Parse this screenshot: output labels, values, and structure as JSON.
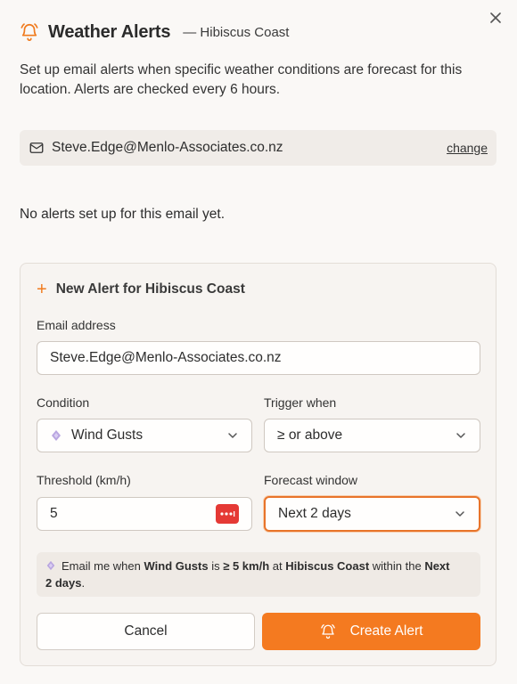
{
  "header": {
    "title": "Weather Alerts",
    "subtitle": "— Hibiscus Coast",
    "accent_color": "#f07b1e"
  },
  "description": "Set up email alerts when specific weather conditions are forecast for this location. Alerts are checked every 6 hours.",
  "email_bar": {
    "address": "Steve.Edge@Menlo-Associates.co.nz",
    "change_label": "change"
  },
  "empty_state": "No alerts set up for this email yet.",
  "new_alert": {
    "title": "New Alert for Hibiscus Coast",
    "email_label": "Email address",
    "email_value": "Steve.Edge@Menlo-Associates.co.nz",
    "condition_label": "Condition",
    "condition_value": "Wind Gusts",
    "trigger_label": "Trigger when",
    "trigger_value": "≥ or above",
    "threshold_label": "Threshold (km/h)",
    "threshold_value": "5",
    "window_label": "Forecast window",
    "window_value": "Next 2 days",
    "summary": {
      "prefix": "Email me when ",
      "condition": "Wind Gusts",
      "mid1": " is ",
      "threshold": "≥ 5 km/h",
      "mid2": " at ",
      "location": "Hibiscus Coast",
      "mid3": " within the ",
      "window_a": "Next",
      "window_b": "2 days",
      "suffix": "."
    },
    "cancel_label": "Cancel",
    "create_label": "Create Alert",
    "create_color": "#f47a20"
  }
}
